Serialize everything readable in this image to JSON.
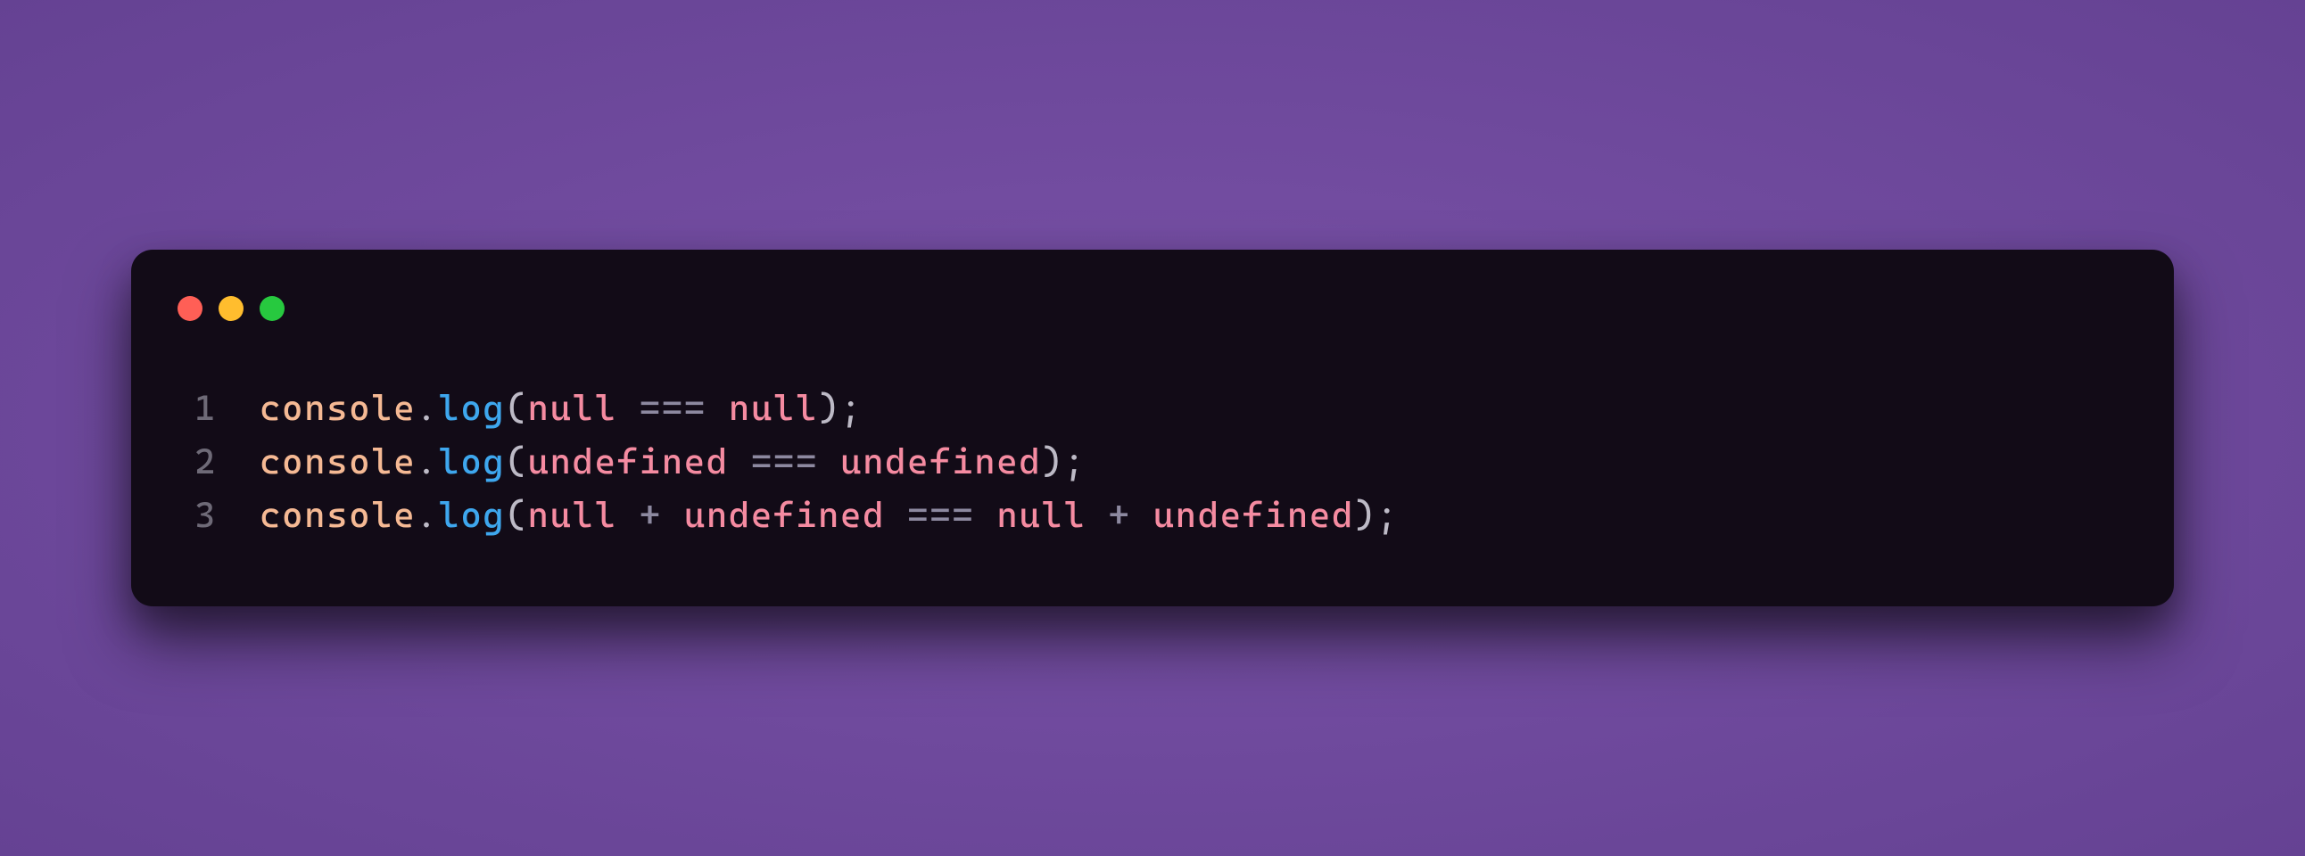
{
  "window": {
    "traffic_lights": {
      "close": "close",
      "minimize": "minimize",
      "maximize": "maximize"
    }
  },
  "colors": {
    "background": "#6a4397",
    "editor_bg": "#120b17",
    "object": "#f5b994",
    "method": "#3ea7ee",
    "keyword": "#f58ba1",
    "operator": "#8d89a0",
    "punctuation": "#bdbac6",
    "linenum": "#6e6a77"
  },
  "code": {
    "lines": [
      {
        "num": "1",
        "tokens": [
          {
            "t": "console",
            "c": "obj"
          },
          {
            "t": ".",
            "c": "punc"
          },
          {
            "t": "log",
            "c": "method"
          },
          {
            "t": "(",
            "c": "punc"
          },
          {
            "t": "null",
            "c": "key"
          },
          {
            "t": " ",
            "c": "punc"
          },
          {
            "t": "===",
            "c": "op"
          },
          {
            "t": " ",
            "c": "punc"
          },
          {
            "t": "null",
            "c": "key"
          },
          {
            "t": ");",
            "c": "punc"
          }
        ]
      },
      {
        "num": "2",
        "tokens": [
          {
            "t": "console",
            "c": "obj"
          },
          {
            "t": ".",
            "c": "punc"
          },
          {
            "t": "log",
            "c": "method"
          },
          {
            "t": "(",
            "c": "punc"
          },
          {
            "t": "undefined",
            "c": "key"
          },
          {
            "t": " ",
            "c": "punc"
          },
          {
            "t": "===",
            "c": "op"
          },
          {
            "t": " ",
            "c": "punc"
          },
          {
            "t": "undefined",
            "c": "key"
          },
          {
            "t": ");",
            "c": "punc"
          }
        ]
      },
      {
        "num": "3",
        "tokens": [
          {
            "t": "console",
            "c": "obj"
          },
          {
            "t": ".",
            "c": "punc"
          },
          {
            "t": "log",
            "c": "method"
          },
          {
            "t": "(",
            "c": "punc"
          },
          {
            "t": "null",
            "c": "key"
          },
          {
            "t": " ",
            "c": "punc"
          },
          {
            "t": "+",
            "c": "op"
          },
          {
            "t": " ",
            "c": "punc"
          },
          {
            "t": "undefined",
            "c": "key"
          },
          {
            "t": " ",
            "c": "punc"
          },
          {
            "t": "===",
            "c": "op"
          },
          {
            "t": " ",
            "c": "punc"
          },
          {
            "t": "null",
            "c": "key"
          },
          {
            "t": " ",
            "c": "punc"
          },
          {
            "t": "+",
            "c": "op"
          },
          {
            "t": " ",
            "c": "punc"
          },
          {
            "t": "undefined",
            "c": "key"
          },
          {
            "t": ");",
            "c": "punc"
          }
        ]
      }
    ]
  }
}
